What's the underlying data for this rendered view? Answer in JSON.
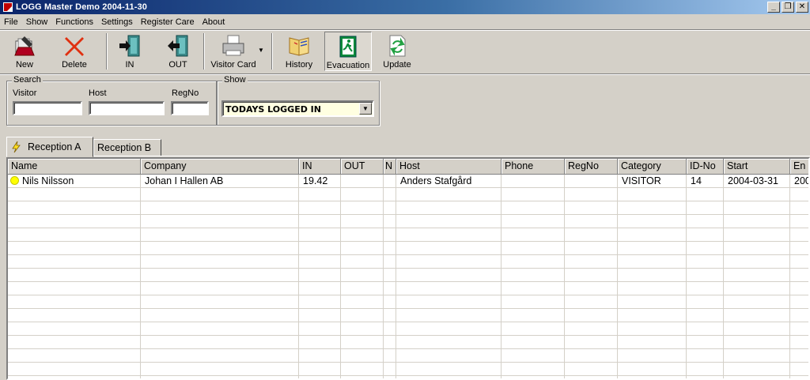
{
  "window": {
    "title": "LOGG Master Demo 2004-11-30",
    "controls": [
      "minimize",
      "restore",
      "close"
    ]
  },
  "menu": [
    "File",
    "Show",
    "Functions",
    "Settings",
    "Register Care",
    "About"
  ],
  "toolbar": {
    "new": "New",
    "delete": "Delete",
    "in": "IN",
    "out": "OUT",
    "visitor_card": "Visitor Card",
    "history": "History",
    "evacuation": "Evacuation",
    "update": "Update"
  },
  "search": {
    "title": "Search",
    "visitor_label": "Visitor",
    "host_label": "Host",
    "regno_label": "RegNo",
    "visitor_value": "",
    "host_value": "",
    "regno_value": ""
  },
  "show": {
    "title": "Show",
    "selected": "TODAYS LOGGED IN"
  },
  "tabs": [
    "Reception A",
    "Reception B"
  ],
  "columns": [
    "Name",
    "Company",
    "IN",
    "OUT",
    "N",
    "Host",
    "Phone",
    "RegNo",
    "Category",
    "ID-No",
    "Start",
    "En"
  ],
  "rows": [
    [
      "Nils Nilsson",
      "Johan I Hallen AB",
      "19.42",
      "",
      "",
      "Anders Stafgård",
      "",
      "",
      "VISITOR",
      "14",
      "2004-03-31",
      "200"
    ]
  ],
  "colors": {
    "status_dot": "#ffff00",
    "combo_bg": "#ffffe1",
    "face": "#d4d0c8"
  }
}
